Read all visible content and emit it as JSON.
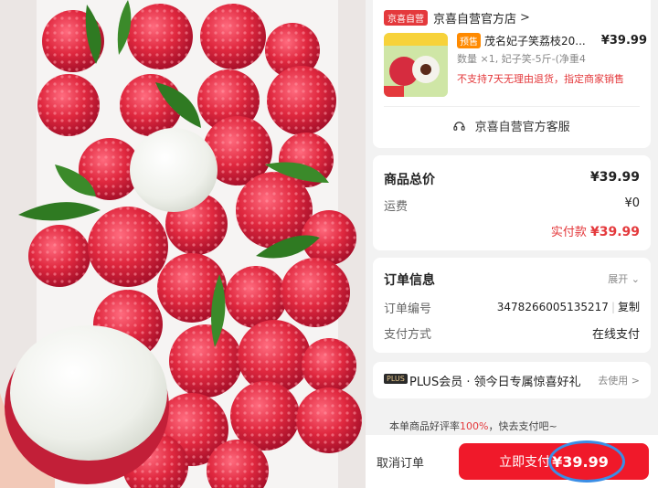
{
  "store": {
    "badge": "京喜自营",
    "name": "京喜自营官方店",
    "chevron": ">"
  },
  "product": {
    "tag": "预售",
    "title": "茂名妃子笑荔枝20...",
    "price": "¥39.99",
    "spec": "数量 ×1, 妃子笑-5斤-(净重4",
    "note": "不支持7天无理由退货，指定商家销售"
  },
  "service": {
    "icon": "headset-icon",
    "label": "京喜自营官方客服"
  },
  "total": {
    "label": "商品总价",
    "value": "¥39.99",
    "shipping_label": "运费",
    "shipping_value": "¥0",
    "actual_label": "实付款",
    "actual_value": "¥39.99"
  },
  "order": {
    "label": "订单信息",
    "expand": "展开",
    "number_label": "订单编号",
    "number_value": "3478266005135217",
    "copy": "复制",
    "payment_label": "支付方式",
    "payment_value": "在线支付"
  },
  "plus": {
    "badge": "PLUS",
    "text": "PLUS会员 · 领今日专属惊喜好礼",
    "go": "去使用 >"
  },
  "rating": {
    "prefix": "本单商品好评率",
    "rate": "100%",
    "suffix": "，快去支付吧~"
  },
  "bottom": {
    "cancel": "取消订单",
    "pay_label": "立即支付",
    "pay_amount": "¥39.99"
  },
  "colors": {
    "accent": "#f0192a",
    "highlight_circle": "#3a8ee6"
  }
}
